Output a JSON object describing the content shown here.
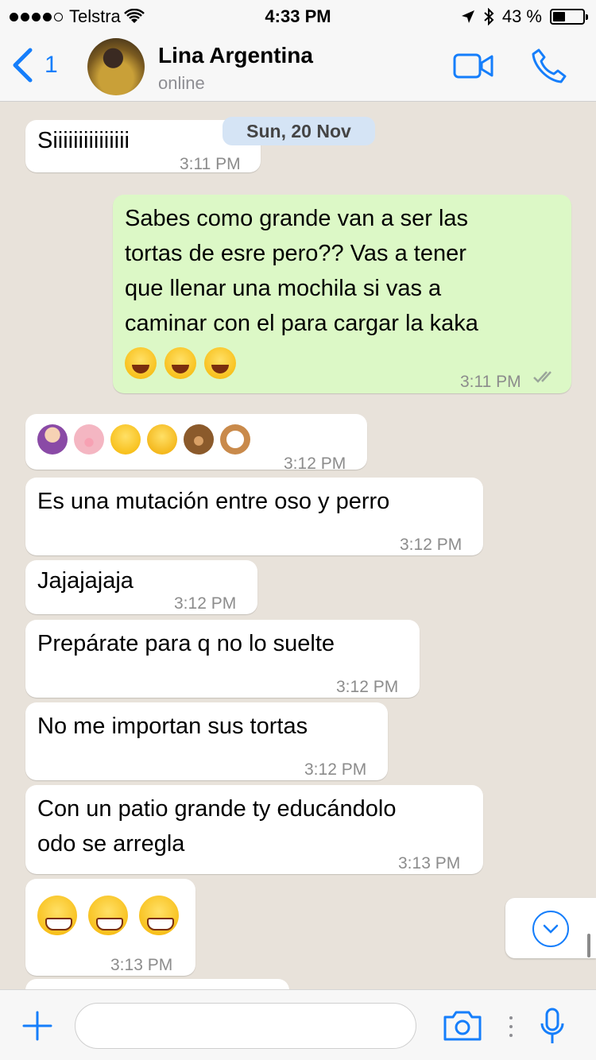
{
  "status_bar": {
    "carrier": "Telstra",
    "time": "4:33 PM",
    "battery": "43 %",
    "battery_level": 0.43
  },
  "header": {
    "back_count": "1",
    "contact_name": "Lina Argentina",
    "contact_status": "online"
  },
  "chat": {
    "date_label": "Sun, 20 Nov",
    "messages": [
      {
        "direction": "in",
        "text": "Siiiiiiiiiiiiiii",
        "time": "3:11 PM"
      },
      {
        "direction": "out",
        "lines": [
          "Sabes como grande van a ser las",
          "tortas de esre pero?? Vas a tener",
          "que llenar una mochila si vas a",
          "caminar con el para cargar la kaka"
        ],
        "emojis": [
          "face-with-tears-of-joy",
          "face-with-tears-of-joy",
          "face-with-tears-of-joy"
        ],
        "time": "3:11 PM",
        "receipt": "read-double-check"
      },
      {
        "direction": "in",
        "emojis": [
          "woman-gesturing-ok",
          "pig-face",
          "heart-eyes",
          "hugging-face",
          "bear-face",
          "dog-face"
        ],
        "time": "3:12 PM"
      },
      {
        "direction": "in",
        "text": "Es una mutación entre oso y perro",
        "time": "3:12 PM"
      },
      {
        "direction": "in",
        "text": "Jajajajaja",
        "time": "3:12 PM"
      },
      {
        "direction": "in",
        "text": "Prepárate para q no lo suelte",
        "time": "3:12 PM"
      },
      {
        "direction": "in",
        "text": "No me importan sus tortas",
        "time": "3:12 PM"
      },
      {
        "direction": "in",
        "lines": [
          "Con un patio grande ty educándolo",
          "odo se arregla"
        ],
        "time": "3:13 PM"
      },
      {
        "direction": "in",
        "emojis": [
          "grinning-face",
          "grinning-face",
          "grinning-face"
        ],
        "time": "3:13 PM"
      }
    ]
  },
  "input": {
    "placeholder": ""
  },
  "colors": {
    "accent": "#157efb",
    "outgoing_bubble": "#dcf8c6",
    "incoming_bubble": "#ffffff",
    "chat_background": "#e8e2da",
    "date_pill": "#d5e4f5"
  }
}
